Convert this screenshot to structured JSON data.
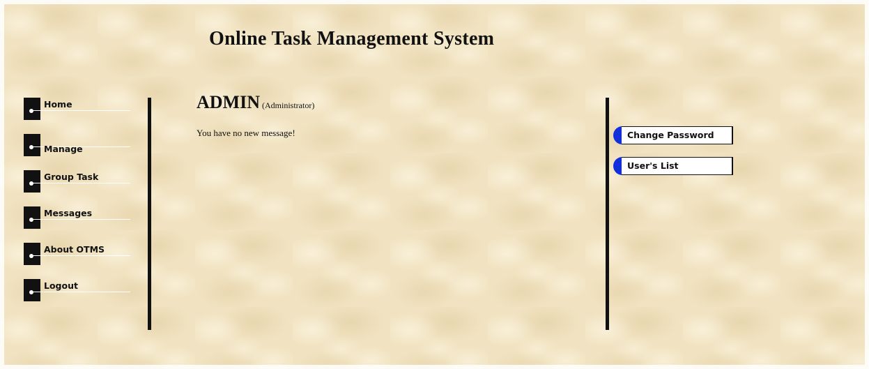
{
  "header": {
    "title": "Online Task Management System"
  },
  "nav": {
    "items": [
      {
        "label": "Home"
      },
      {
        "label": "Manage"
      },
      {
        "label": "Group Task"
      },
      {
        "label": "Messages"
      },
      {
        "label": "About OTMS"
      },
      {
        "label": "Logout"
      }
    ]
  },
  "user": {
    "name": "ADMIN",
    "role": "(Administrator)"
  },
  "main": {
    "message": "You have no new message!"
  },
  "actions": {
    "change_password": "Change Password",
    "users_list": "User's List"
  },
  "colors": {
    "accent": "#1230d9",
    "background": "#f1e3c1",
    "text": "#111111"
  }
}
